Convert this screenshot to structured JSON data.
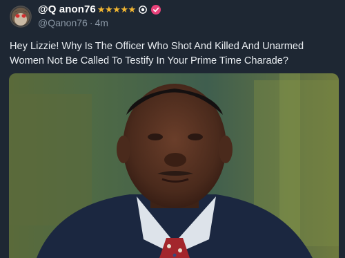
{
  "post": {
    "display_name": "@Q anon76",
    "rating_stars": "★★★★★",
    "handle": "@Qanon76",
    "separator": "·",
    "timestamp": "4m",
    "text": "Hey Lizzie! Why Is The Officer Who Shot And Killed And Unarmed Women Not Be Called To Testify In Your Prime Time Charade?",
    "star_color": "#f2b632",
    "verified_color": "#e8417a"
  },
  "icons": {
    "avatar": "avatar-image",
    "circle_badge": "registered-circle-icon",
    "verified": "verified-badge-icon"
  },
  "media": {
    "kind": "photo",
    "subject": "man in suit and red patterned tie"
  }
}
